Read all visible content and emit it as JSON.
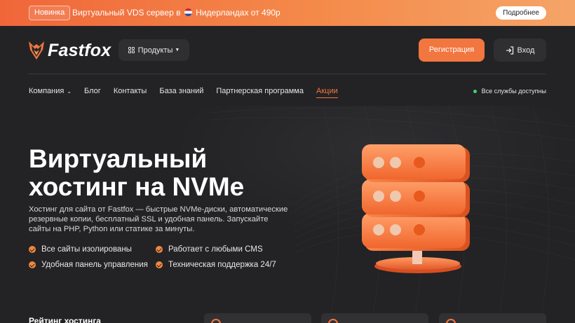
{
  "promo": {
    "badge": "Новинка",
    "text_before": "Виртуальный VDS сервер в",
    "text_after": "Нидерландах от 490р",
    "more_label": "Подробнее"
  },
  "header": {
    "logo_text": "Fastfox",
    "products_label": "Продукты",
    "register_label": "Регистрация",
    "login_label": "Вход"
  },
  "nav": {
    "items": [
      {
        "label": "Компания",
        "has_dropdown": true,
        "active": false
      },
      {
        "label": "Блог",
        "active": false
      },
      {
        "label": "Контакты",
        "active": false
      },
      {
        "label": "База знаний",
        "active": false
      },
      {
        "label": "Партнерская программа",
        "active": false
      },
      {
        "label": "Акции",
        "active": true
      }
    ],
    "status": "Все службы доступны"
  },
  "hero": {
    "title_line1": "Виртуальный",
    "title_line2": "хостинг на NVMe",
    "description": "Хостинг для сайта от Fastfox — быстрые NVMe-диски, автоматические резервные копии, бесплатный SSL и удобная панель. Запускайте сайты на PHP, Python или статике за минуты.",
    "features": [
      "Все сайты изолированы",
      "Работает с любыми CMS",
      "Удобная панель управления",
      "Техническая поддержка 24/7"
    ]
  },
  "rating": {
    "title": "Рейтинг хостинга"
  },
  "colors": {
    "accent": "#f2763f",
    "background": "#232325",
    "status_ok": "#3fd46b"
  }
}
